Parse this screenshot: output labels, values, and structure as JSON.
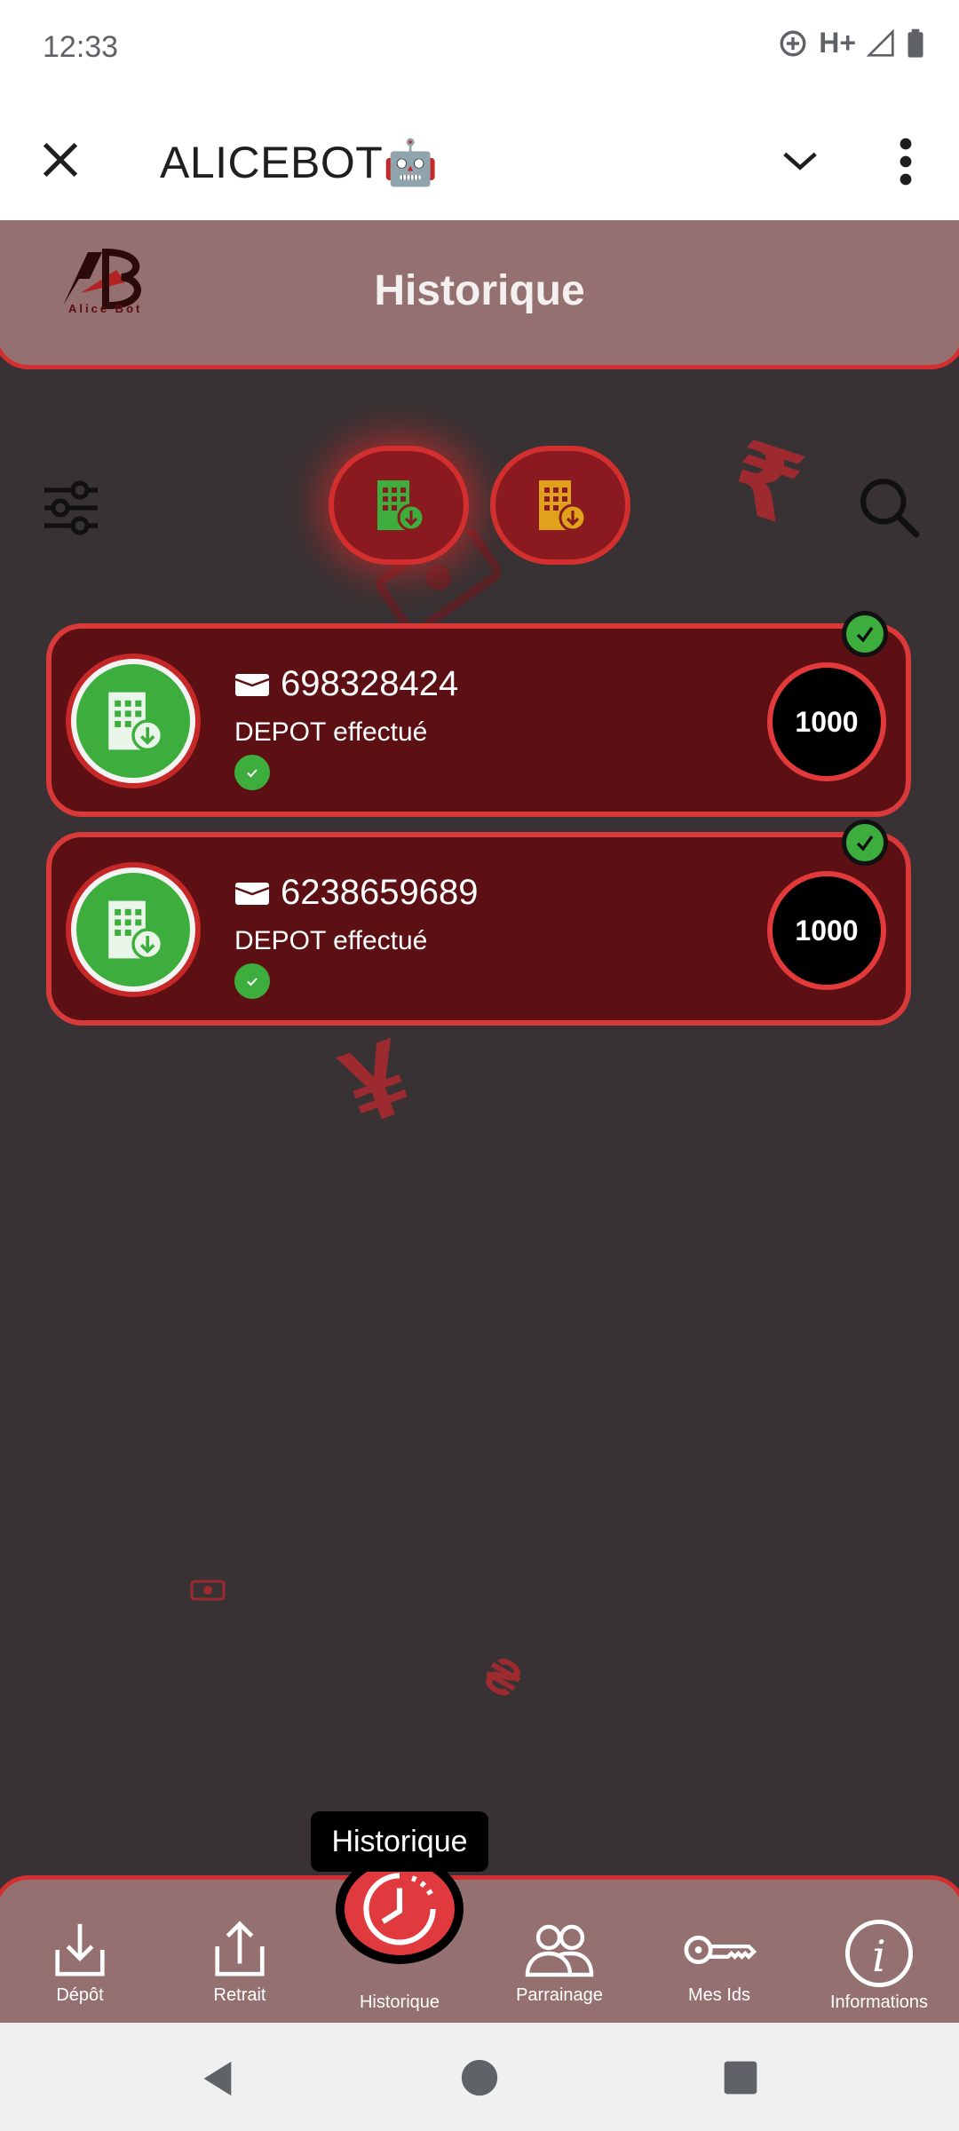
{
  "status_bar": {
    "time": "12:33",
    "network": "H+"
  },
  "appbar": {
    "title": "ALICEBOT🤖"
  },
  "header": {
    "title": "Historique",
    "logo_text": "Alice Bot"
  },
  "transactions": [
    {
      "number": "698328424",
      "status": "DEPOT effectué",
      "amount": "1000"
    },
    {
      "number": "6238659689",
      "status": "DEPOT effectué",
      "amount": "1000"
    }
  ],
  "tooltip": {
    "text": "Historique"
  },
  "bottom_nav": {
    "items": [
      {
        "label": "Dépôt",
        "icon": "download-icon"
      },
      {
        "label": "Retrait",
        "icon": "upload-icon"
      },
      {
        "label": "Historique",
        "icon": "clock-icon"
      },
      {
        "label": "Parrainage",
        "icon": "users-icon"
      },
      {
        "label": "Mes Ids",
        "icon": "key-icon"
      },
      {
        "label": "Informations",
        "icon": "info-icon"
      }
    ]
  },
  "colors": {
    "accent": "#d32f2f",
    "success": "#3dae3d",
    "card": "#5c1014",
    "header": "#957070",
    "background": "#383234"
  }
}
